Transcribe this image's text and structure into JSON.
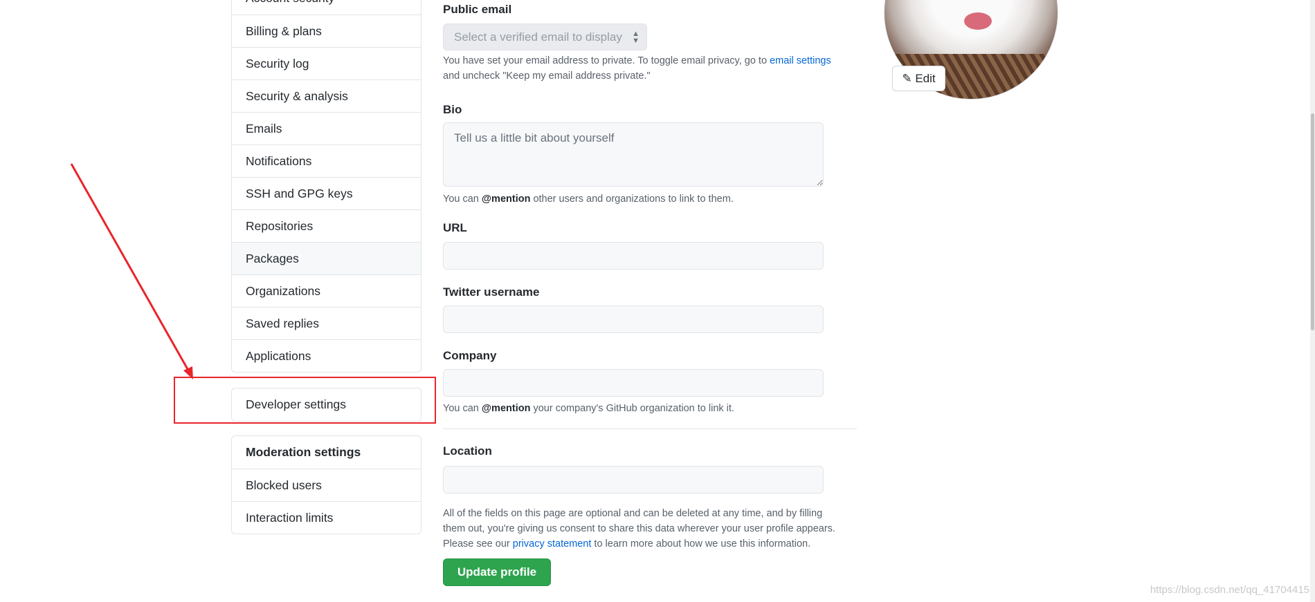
{
  "sidebar": {
    "items": [
      "Account security",
      "Billing & plans",
      "Security log",
      "Security & analysis",
      "Emails",
      "Notifications",
      "SSH and GPG keys",
      "Repositories",
      "Packages",
      "Organizations",
      "Saved replies",
      "Applications"
    ],
    "developer": "Developer settings",
    "moderation": {
      "header": "Moderation settings",
      "items": [
        "Blocked users",
        "Interaction limits"
      ]
    }
  },
  "form": {
    "public_email": {
      "label": "Public email",
      "placeholder": "Select a verified email to display",
      "help_pre": "You have set your email address to private. To toggle email privacy, go to ",
      "help_link": "email settings",
      "help_post": " and uncheck \"Keep my email address private.\""
    },
    "bio": {
      "label": "Bio",
      "placeholder": "Tell us a little bit about yourself",
      "help_pre": "You can ",
      "help_bold": "@mention",
      "help_post": " other users and organizations to link to them."
    },
    "url": {
      "label": "URL",
      "value": ""
    },
    "twitter": {
      "label": "Twitter username",
      "value": ""
    },
    "company": {
      "label": "Company",
      "value": "",
      "help_pre": "You can ",
      "help_bold": "@mention",
      "help_post": " your company's GitHub organization to link it."
    },
    "location": {
      "label": "Location",
      "value": ""
    },
    "notice_1": "All of the fields on this page are optional and can be deleted at any time, and by filling",
    "notice_2": "them out, you're giving us consent to share this data wherever your user profile appears.",
    "notice_3_pre": "Please see our ",
    "notice_3_link": "privacy statement",
    "notice_3_post": " to learn more about how we use this information.",
    "submit": "Update profile"
  },
  "avatar": {
    "edit_label": "Edit"
  },
  "watermark": "https://blog.csdn.net/qq_41704415",
  "colors": {
    "accent": "#0366d6",
    "primary_button": "#2ea44f",
    "annotation": "#e8252b"
  }
}
